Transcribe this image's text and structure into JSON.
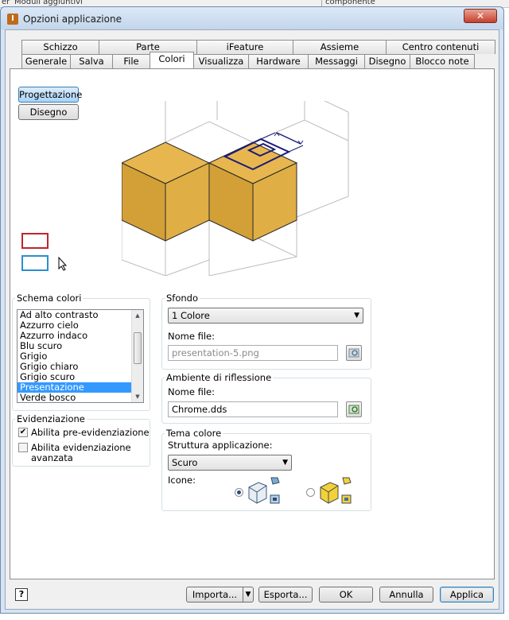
{
  "background": {
    "left_fragment": "er",
    "menu_text": "Moduli aggiuntivi",
    "right_text": "componente"
  },
  "window": {
    "title": "Opzioni applicazione",
    "close_glyph": "✕",
    "icon_letter": "I"
  },
  "tabs": {
    "row1": [
      "Schizzo",
      "Parte",
      "iFeature",
      "Assieme",
      "Centro contenuti"
    ],
    "row2": [
      "Generale",
      "Salva",
      "File",
      "Colori",
      "Visualizza",
      "Hardware",
      "Messaggi",
      "Disegno",
      "Blocco note"
    ],
    "active": "Colori"
  },
  "preview": {
    "mode_buttons": [
      "Progettazione",
      "Disegno"
    ],
    "selected_mode": "Progettazione",
    "colors": {
      "cube_face": "#e8b64f",
      "cube_side": "#d3a037",
      "wire": "#bdbdbd",
      "dimension": "#1c1c78",
      "sample_red": "#c0262c",
      "sample_blue": "#2c8fd0"
    }
  },
  "schema_colori": {
    "label": "Schema colori",
    "items": [
      "Ad alto contrasto",
      "Azzurro cielo",
      "Azzurro indaco",
      "Blu scuro",
      "Grigio",
      "Grigio chiaro",
      "Grigio scuro",
      "Presentazione",
      "Verde bosco"
    ],
    "selected": "Presentazione"
  },
  "evidenziazione": {
    "label": "Evidenziazione",
    "pre": {
      "label": "Abilita pre-evidenziazione",
      "checked": true
    },
    "advanced": {
      "label_line1": "Abilita evidenziazione",
      "label_line2": "avanzata",
      "checked": false
    }
  },
  "sfondo": {
    "label": "Sfondo",
    "select_value": "1 Colore",
    "file_label": "Nome file:",
    "file_value": "presentation-5.png"
  },
  "riflessione": {
    "label": "Ambiente di riflessione",
    "file_label": "Nome file:",
    "file_value": "Chrome.dds"
  },
  "tema": {
    "label": "Tema colore",
    "struttura_label": "Struttura applicazione:",
    "struttura_value": "Scuro",
    "icone_label": "Icone:",
    "selected_icon": "classic"
  },
  "footer": {
    "help": "?",
    "importa": "Importa...",
    "esporta": "Esporta...",
    "ok": "OK",
    "annulla": "Annulla",
    "applica": "Applica"
  }
}
